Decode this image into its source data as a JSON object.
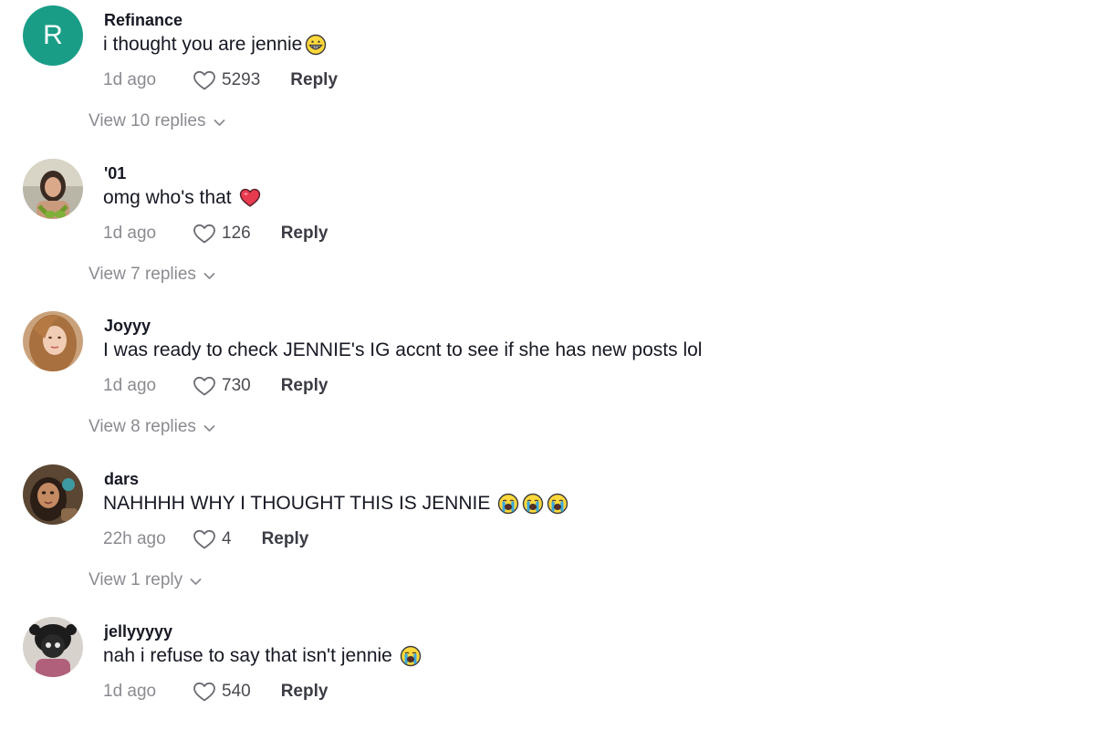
{
  "comments": [
    {
      "username": "Refinance",
      "avatar_letter": "R",
      "avatar_color": "#1a9d87",
      "text": "i thought you are jennie",
      "emojis": [
        "grinning-face"
      ],
      "time": "1d ago",
      "likes": "5293",
      "reply_label": "Reply",
      "view_replies": "View 10 replies"
    },
    {
      "username": "'01",
      "text": "omg who's that",
      "emojis": [
        "red-heart"
      ],
      "time": "1d ago",
      "likes": "126",
      "reply_label": "Reply",
      "view_replies": "View 7 replies"
    },
    {
      "username": "Joyyy",
      "text": "I was ready to check JENNIE's IG accnt to see if she has new posts lol",
      "emojis": [],
      "time": "1d ago",
      "likes": "730",
      "reply_label": "Reply",
      "view_replies": "View 8 replies"
    },
    {
      "username": "dars",
      "text": "NAHHHH WHY I THOUGHT THIS IS JENNIE",
      "emojis": [
        "loudly-crying-face",
        "loudly-crying-face",
        "loudly-crying-face"
      ],
      "time": "22h ago",
      "likes": "4",
      "reply_label": "Reply",
      "view_replies": "View 1 reply"
    },
    {
      "username": "jellyyyyy",
      "text": "nah i refuse to say that isn't jennie",
      "emojis": [
        "loudly-crying-face"
      ],
      "time": "1d ago",
      "likes": "540",
      "reply_label": "Reply"
    }
  ],
  "colors": {
    "text": "#161823",
    "muted": "#8a8b91",
    "accent_avatar": "#1a9d87"
  },
  "icons": {
    "like": "heart-outline-icon",
    "expand": "chevron-down-icon"
  }
}
